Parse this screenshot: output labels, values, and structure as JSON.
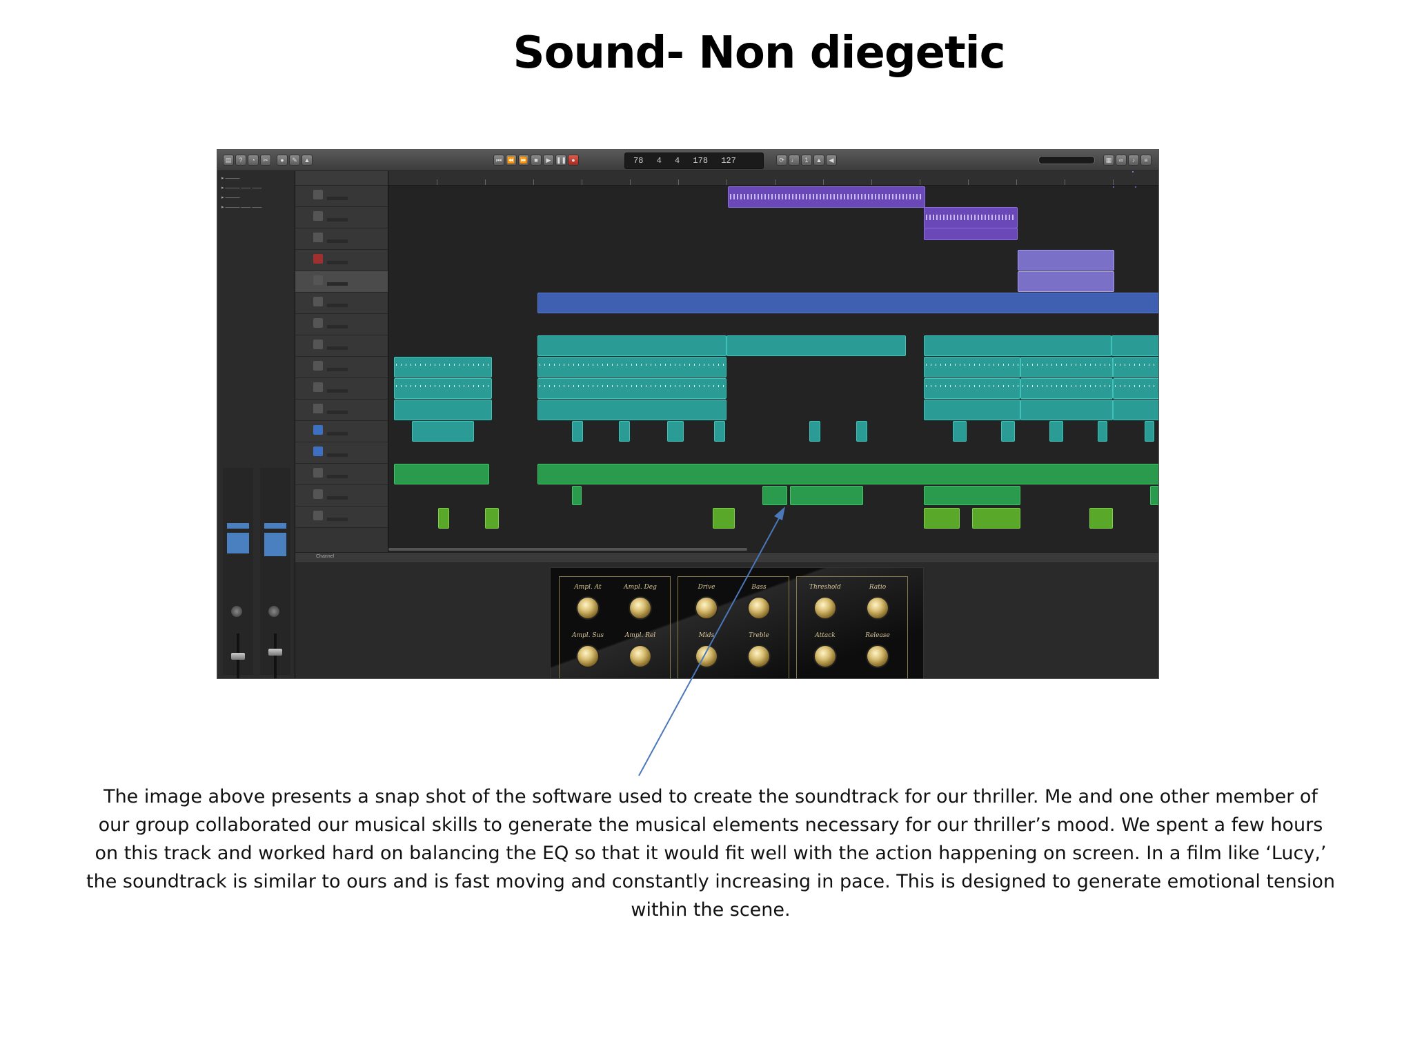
{
  "slide": {
    "title": "Sound- Non diegetic",
    "caption_lines": [
      "The image above presents a snap shot of the software used to create the soundtrack for our thriller. Me and one other member of",
      "our group collaborated our musical skills to generate the musical elements necessary for our thriller’s mood. We spent a few hours",
      "on this track and worked hard on balancing the EQ so that it would fit well with the action happening on screen. In a film like ‘Lucy,’",
      "the soundtrack is similar to ours and is fast moving and constantly increasing in pace. This is designed to generate emotional tension",
      "within the scene."
    ]
  },
  "daw": {
    "lcd": {
      "bar": "78",
      "beat": "4",
      "extra": "4",
      "tempo": "178",
      "sig": "127"
    },
    "editor_tab": "Channel",
    "plugin": {
      "panels": [
        {
          "labels": [
            "Ampl. At",
            "Ampl. Deg",
            "Ampl. Sus",
            "Ampl. Rel"
          ]
        },
        {
          "labels": [
            "Drive",
            "Bass",
            "Mids",
            "Treble"
          ]
        },
        {
          "labels": [
            "Threshold",
            "Ratio",
            "Attack",
            "Release"
          ]
        }
      ]
    },
    "colors": {
      "audio_purple": "#6a48b8",
      "drummer_teal": "#2a9c95",
      "midi_green": "#2a9a4c",
      "region_blue": "#3f5fb0",
      "knob_gold": "#d8be72"
    }
  }
}
